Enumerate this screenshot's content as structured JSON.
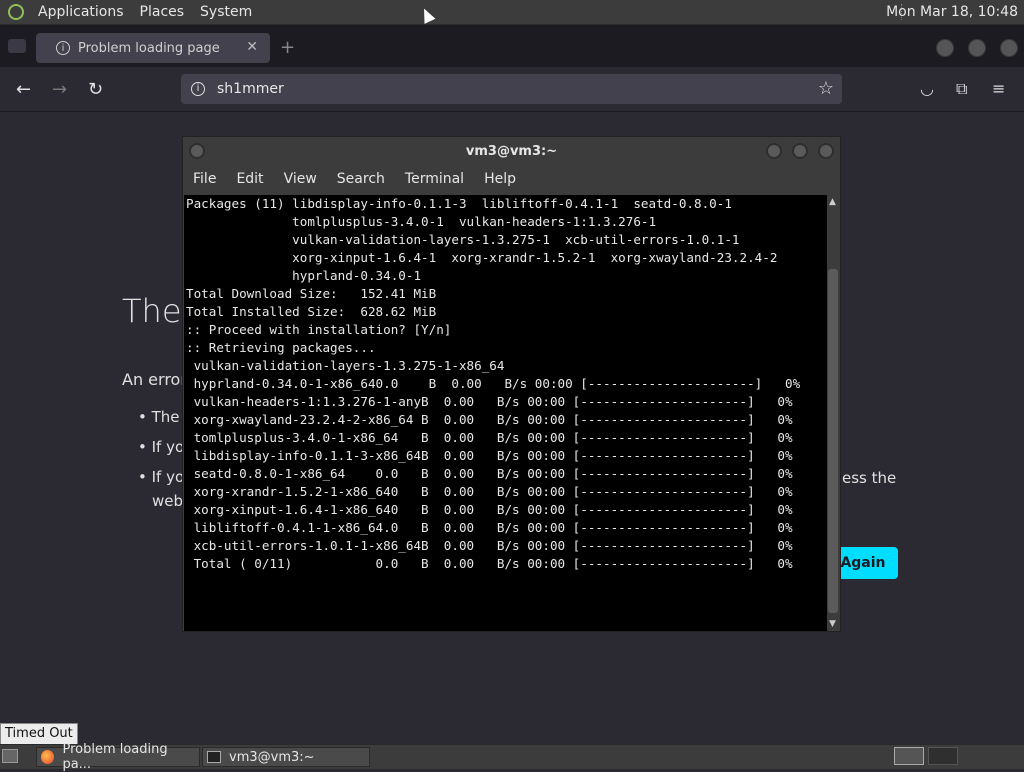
{
  "top_panel": {
    "menus": [
      "Applications",
      "Places",
      "System"
    ],
    "clock": "Mon Mar 18, 10:48"
  },
  "browser": {
    "tab_title": "Problem loading page",
    "url": "sh1mmer",
    "page": {
      "title_partial": "The",
      "desc_partial": "An error",
      "bullets": [
        "The s",
        "If you",
        "If you"
      ],
      "bullet3_wrap": "web",
      "right_text": "ess the",
      "try_again": "Again"
    }
  },
  "terminal": {
    "title": "vm3@vm3:~",
    "menu": [
      "File",
      "Edit",
      "View",
      "Search",
      "Terminal",
      "Help"
    ],
    "lines": [
      "Packages (11) libdisplay-info-0.1.1-3  libliftoff-0.4.1-1  seatd-0.8.0-1",
      "              tomlplusplus-3.4.0-1  vulkan-headers-1:1.3.276-1",
      "              vulkan-validation-layers-1.3.275-1  xcb-util-errors-1.0.1-1",
      "              xorg-xinput-1.6.4-1  xorg-xrandr-1.5.2-1  xorg-xwayland-23.2.4-2",
      "              hyprland-0.34.0-1",
      "",
      "Total Download Size:   152.41 MiB",
      "Total Installed Size:  628.62 MiB",
      "",
      ":: Proceed with installation? [Y/n]",
      ":: Retrieving packages...",
      " vulkan-validation-layers-1.3.275-1-x86_64",
      " hyprland-0.34.0-1-x86_640.0    B  0.00   B/s 00:00 [----------------------]   0%",
      " vulkan-headers-1:1.3.276-1-anyB  0.00   B/s 00:00 [----------------------]   0%",
      " xorg-xwayland-23.2.4-2-x86_64 B  0.00   B/s 00:00 [----------------------]   0%",
      " tomlplusplus-3.4.0-1-x86_64   B  0.00   B/s 00:00 [----------------------]   0%",
      " libdisplay-info-0.1.1-3-x86_64B  0.00   B/s 00:00 [----------------------]   0%",
      " seatd-0.8.0-1-x86_64    0.0   B  0.00   B/s 00:00 [----------------------]   0%",
      " xorg-xrandr-1.5.2-1-x86_640   B  0.00   B/s 00:00 [----------------------]   0%",
      " xorg-xinput-1.6.4-1-x86_640   B  0.00   B/s 00:00 [----------------------]   0%",
      " libliftoff-0.4.1-1-x86_64.0   B  0.00   B/s 00:00 [----------------------]   0%",
      " xcb-util-errors-1.0.1-1-x86_64B  0.00   B/s 00:00 [----------------------]   0%",
      " Total ( 0/11)           0.0   B  0.00   B/s 00:00 [----------------------]   0%"
    ]
  },
  "tooltip": "Timed Out",
  "taskbar": {
    "items": [
      "Problem loading pa...",
      "vm3@vm3:~"
    ]
  },
  "colors": {
    "accent": "#00ddff",
    "panel": "#3c3c3c",
    "page_bg": "#2b2a33"
  }
}
